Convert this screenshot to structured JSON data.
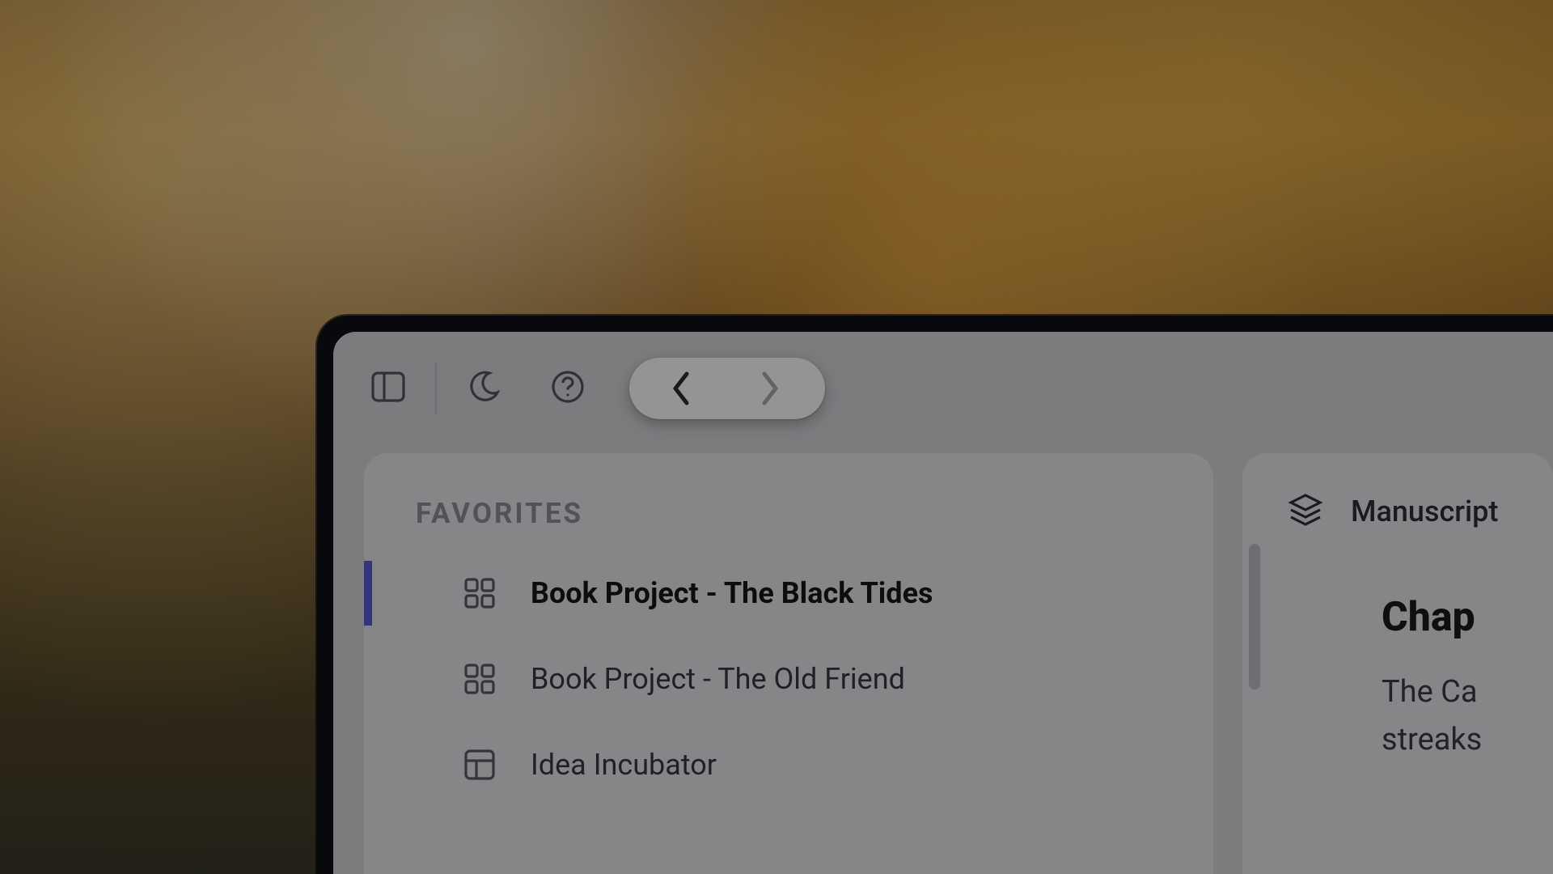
{
  "toolbar": {
    "sidebar_toggle": "sidebar-toggle",
    "dark_mode": "dark-mode",
    "help": "help",
    "back": "back",
    "forward": "forward"
  },
  "sidebar": {
    "favorites_label": "FAVORITES",
    "items": [
      {
        "label": "Book Project - The Black Tides",
        "icon": "dashboard-icon",
        "active": true
      },
      {
        "label": "Book Project - The Old Friend",
        "icon": "dashboard-icon",
        "active": false
      },
      {
        "label": "Idea Incubator",
        "icon": "table-icon",
        "active": false
      }
    ]
  },
  "main": {
    "header_icon": "layers-icon",
    "header_label": "Manuscript",
    "chapter_title": "Chap",
    "body_line1": "The Ca",
    "body_line2": "streaks"
  }
}
